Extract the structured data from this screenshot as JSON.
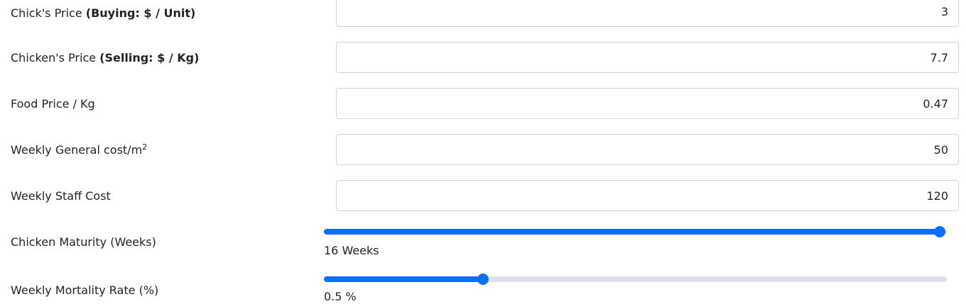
{
  "fields": [
    {
      "label": "Chick's Price ",
      "label_bold": "(Buying: $ / Unit)",
      "value": "3"
    },
    {
      "label": "Chicken's Price ",
      "label_bold": "(Selling: $ / Kg)",
      "value": "7.7"
    },
    {
      "label": "Food Price / Kg",
      "value": "0.47"
    },
    {
      "label": "Weekly General cost/m",
      "label_sup": "2",
      "value": "50"
    },
    {
      "label": "Weekly Staff Cost",
      "value": "120"
    }
  ],
  "sliders": [
    {
      "label": "Chicken Maturity (Weeks)",
      "value_text": "16 Weeks",
      "fraction": 1.0
    },
    {
      "label": "Weekly Mortality Rate (%)",
      "value_text": "0.5 %",
      "fraction": 0.25
    }
  ],
  "colors": {
    "accent": "#0d6efd",
    "track": "#dee2e6",
    "border": "#ced4da",
    "text": "#212529"
  }
}
